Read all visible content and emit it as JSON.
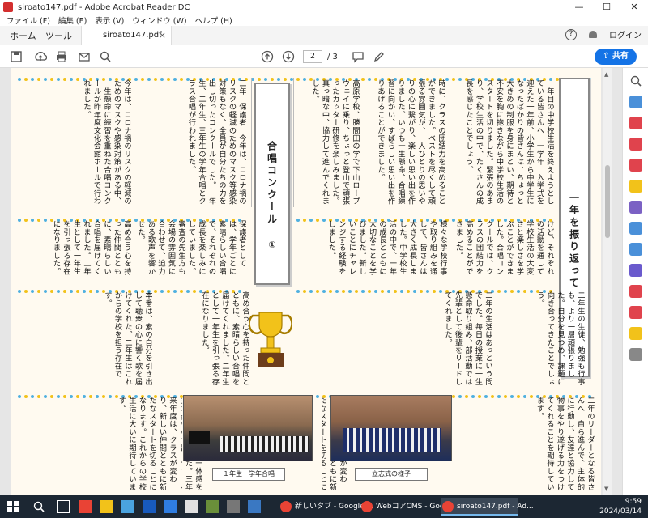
{
  "window": {
    "title": "siroato147.pdf - Adobe Acrobat Reader DC",
    "minimize": "—",
    "maximize": "☐",
    "close": "✕"
  },
  "menu": [
    "ファイル (F)",
    "編集 (E)",
    "表示 (V)",
    "ウィンドウ (W)",
    "ヘルプ (H)"
  ],
  "tabs": {
    "home": "ホーム",
    "tools": "ツール",
    "document": "siroato147.pdf",
    "close": "×",
    "help": "?",
    "login": "ログイン"
  },
  "toolbar": {
    "page_current": "2",
    "page_total": "/ 3",
    "share": "共有"
  },
  "article": {
    "section_title": "一年を振り返って",
    "choir_title": "合唱コンクール",
    "choir_number": "①",
    "col_a": "一年目の中学校生活を終えようとしている皆さんへ　一学年　入学式を迎えた一年前、小学生から中学生になったばかりの皆さんは、ちょっと大きめの制服を身にまとい、期待と不安を胸に抱きながら中学校生活のスタートを切りました。緊張のあまり、学校生活の中で、たくさんの成長を感じたことでしょう。",
    "col_b": "時に、クラスの団結力を高めることができました。ベストを尽くして頑張る雰囲気が、一人ひとりの思いやりの心に繋がり、楽しい思い出を作りました。いつも一生懸命、合唱練習に向かい、すばらしい思い出を作りあげることができました。",
    "col_c": "高原学校、勝間田の学で下山ロープウェイに乗り、ちょっと登山で頑張ったカッター研修を楽しみました。真っ暗な中、協力して進んでくれました。",
    "col_d": "今年は、コロナ禍のリスクの軽減のためのマスクや感染対策がある中、一生懸命に練習を重ねた合唱コンクールが昨年度文化会館ホールで行われました。",
    "col_e": "三年　保護者　今年は、コロナ禍のリスクの軽減のためのマスク等感染対策もなく、全員が自分たちの力を出し切ったコンクールでした。一年生、二年生、三年生の学年合唱とクラス合唱が行われました。",
    "col_f": "保護者としては、学年ごとに素晴らしい合唱で、それぞれの成長を楽しみにしていました。審査の先生方も会場の雰囲気に合わせて、迫力ある歌声を響かせた。",
    "col_g": "様々な学校行事や取り組みを通して、皆さんは大きく成長しました。中学校生活の中で、一年の成長とともに大切なことを学びました。新しいことにチャレンジする経験をしました。",
    "col_h": "けど、それぞれの活動を通して学校生活の大変さと楽しさを学ぶことができました。合唱コンクールでは、クラスの団結力を高めることができました。",
    "col_i": "二年生の生徒、勉強も行事も、より一層頑張りました。自分を見つめ、課題に向き合ってきたことでしょう。",
    "col_j": "二年の生活はあっという間でした。毎日の授業に一生懸命取り組み、部活動では先輩として後輩をリードしてくれました。",
    "col_k": "高め合う心を持った仲間とともに、素晴らしい合唱を届けてくれました。二年生として一年生を引っ張る存在になりました。",
    "col_l": "本番は、素の自分を引き出して聴衆の心に響く歌を届けてくれた。二年生はこれからの学校を担う存在です。",
    "col_m": "二年のリーダーとなる皆さんへ　自ら進んで、主体的に行動し、友達と協力して物事をやり遂げる力をつけてくれることを期待しています。",
    "col_n": "に触れて、全員で一体感を持って合唱しました。三年生は最後の合唱コンクールで、感動を与える歌声を響かせました。",
    "col_o": "来年度は、クラスが変わり、新しい仲間とともに新たなスタートを切ることになります。これからの学校生活に大いに期待しています。",
    "caption_left": "１年生　学年合唱",
    "caption_right": "立志式の様子"
  },
  "taskbar": {
    "apps": [
      "新しいタブ - Google ...",
      "WebコアCMS - Goo...",
      "siroato147.pdf - Ad..."
    ],
    "time": "9:59",
    "date": "2024/03/14"
  },
  "colors": {
    "accent": "#1473e6",
    "dot_blue": "#4fb0e0",
    "dot_yellow": "#f2c21a",
    "page_bg": "#fffaf0"
  }
}
